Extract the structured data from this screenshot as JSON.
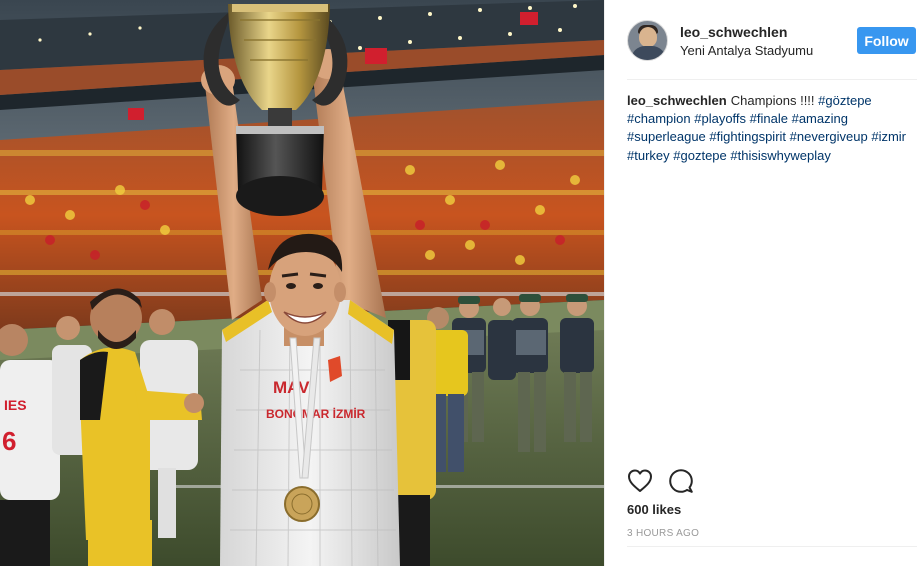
{
  "post": {
    "username": "leo_schwechlen",
    "location": "Yeni Antalya Stadyumu",
    "follow_label": "Follow",
    "caption_text": "Champions !!!!",
    "hashtags": [
      "#göztepe",
      "#champion",
      "#playoffs",
      "#finale",
      "#amazing",
      "#superleague",
      "#fightingspirit",
      "#nevergiveup",
      "#izmir",
      "#turkey",
      "#goztepe",
      "#thisiswhyweplay"
    ],
    "likes": "600 likes",
    "time_ago": "3 HOURS AGO"
  },
  "photo": {
    "jersey_text_line1": "MAVİ",
    "jersey_text_line2": "BONOMAR İZMİR",
    "left_player_text": "IES"
  },
  "icons": {
    "like": "heart-icon",
    "comment": "comment-icon"
  },
  "colors": {
    "follow_button": "#3897f0",
    "hashtag": "#003569",
    "timestamp": "#999999",
    "text": "#262626"
  }
}
